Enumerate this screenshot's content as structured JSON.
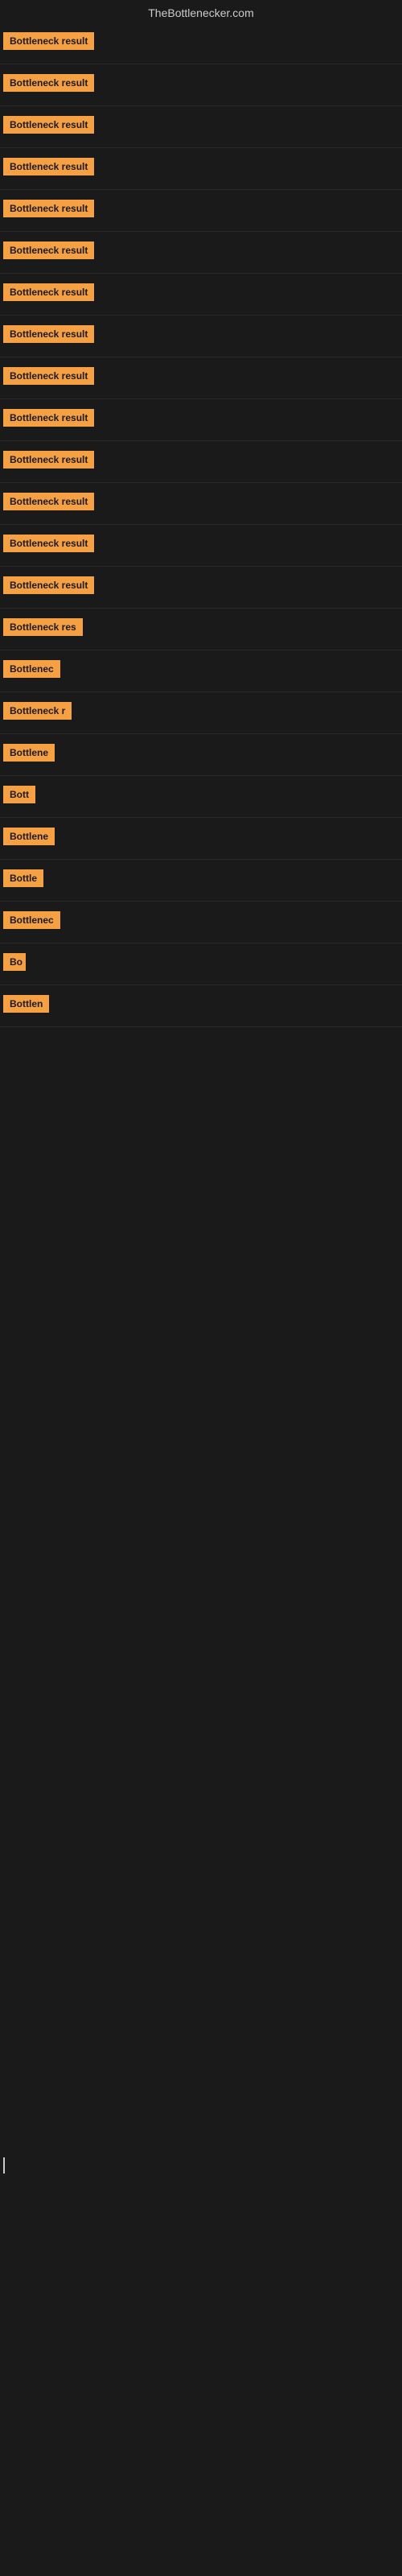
{
  "site": {
    "title": "TheBottlenecker.com"
  },
  "rows": [
    {
      "id": 1,
      "label": "Bottleneck result",
      "width": 130
    },
    {
      "id": 2,
      "label": "Bottleneck result",
      "width": 130
    },
    {
      "id": 3,
      "label": "Bottleneck result",
      "width": 130
    },
    {
      "id": 4,
      "label": "Bottleneck result",
      "width": 130
    },
    {
      "id": 5,
      "label": "Bottleneck result",
      "width": 130
    },
    {
      "id": 6,
      "label": "Bottleneck result",
      "width": 130
    },
    {
      "id": 7,
      "label": "Bottleneck result",
      "width": 130
    },
    {
      "id": 8,
      "label": "Bottleneck result",
      "width": 130
    },
    {
      "id": 9,
      "label": "Bottleneck result",
      "width": 130
    },
    {
      "id": 10,
      "label": "Bottleneck result",
      "width": 130
    },
    {
      "id": 11,
      "label": "Bottleneck result",
      "width": 130
    },
    {
      "id": 12,
      "label": "Bottleneck result",
      "width": 130
    },
    {
      "id": 13,
      "label": "Bottleneck result",
      "width": 130
    },
    {
      "id": 14,
      "label": "Bottleneck result",
      "width": 130
    },
    {
      "id": 15,
      "label": "Bottleneck res",
      "width": 110
    },
    {
      "id": 16,
      "label": "Bottlenec",
      "width": 80
    },
    {
      "id": 17,
      "label": "Bottleneck r",
      "width": 90
    },
    {
      "id": 18,
      "label": "Bottlene",
      "width": 72
    },
    {
      "id": 19,
      "label": "Bott",
      "width": 42
    },
    {
      "id": 20,
      "label": "Bottlene",
      "width": 72
    },
    {
      "id": 21,
      "label": "Bottle",
      "width": 56
    },
    {
      "id": 22,
      "label": "Bottlenec",
      "width": 76
    },
    {
      "id": 23,
      "label": "Bo",
      "width": 28
    },
    {
      "id": 24,
      "label": "Bottlen",
      "width": 62
    }
  ]
}
